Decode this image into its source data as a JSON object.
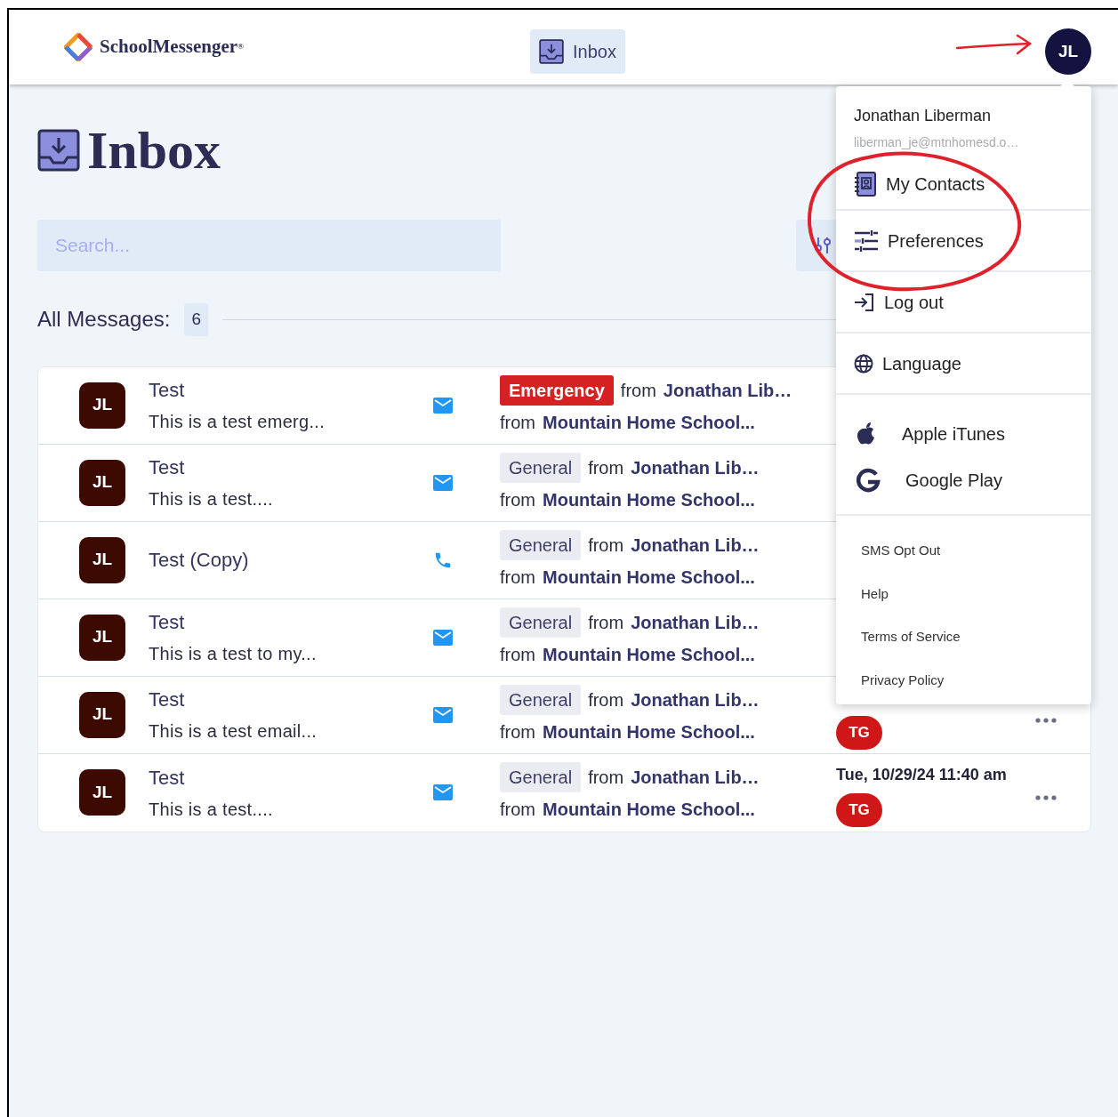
{
  "header": {
    "logo": "SchoolMessenger$^{®}$",
    "nav": [
      {
        "label": "Inbox",
        "selected": true
      }
    ],
    "avatar": "JL"
  },
  "page_title": "Inbox",
  "search": {
    "placeholder": "Search..."
  },
  "summary": {
    "label": "All Messages:",
    "count": "6"
  },
  "messages": [
    {
      "avatar": "JL",
      "title": "Test",
      "preview": "This is a test emerg...",
      "kind": "email",
      "tag": {
        "kind": "emergency",
        "label": "Emergency"
      },
      "sender_prefix": "from",
      "sender": "Jonathan Lib…",
      "org_prefix": "from",
      "org": "Mountain Home School..."
    },
    {
      "avatar": "JL",
      "title": "Test",
      "preview": "This is a test....",
      "kind": "email",
      "tag": {
        "kind": "general",
        "label": "General"
      },
      "sender_prefix": "from",
      "sender": "Jonathan Lib…",
      "org_prefix": "from",
      "org": "Mountain Home School..."
    },
    {
      "avatar": "JL",
      "title": "Test (Copy)",
      "kind": "phone",
      "tag": {
        "kind": "general",
        "label": "General"
      },
      "sender_prefix": "from",
      "sender": "Jonathan Lib…",
      "org_prefix": "from",
      "org": "Mountain Home School..."
    },
    {
      "avatar": "JL",
      "title": "Test",
      "preview": "This is a test to my...",
      "kind": "email",
      "tag": {
        "kind": "general",
        "label": "General"
      },
      "sender_prefix": "from",
      "sender": "Jonathan Lib…",
      "org_prefix": "from",
      "org": "Mountain Home School..."
    },
    {
      "avatar": "JL",
      "title": "Test",
      "preview": "This is a test email...",
      "kind": "email",
      "tag": {
        "kind": "general",
        "label": "General"
      },
      "sender_prefix": "from",
      "sender": "Jonathan Lib…",
      "org_prefix": "from",
      "org": "Mountain Home School...",
      "badge": "TG",
      "more": true
    },
    {
      "avatar": "JL",
      "title": "Test",
      "preview": "This is a test....",
      "kind": "email",
      "tag": {
        "kind": "general",
        "label": "General"
      },
      "sender_prefix": "from",
      "sender": "Jonathan Lib…",
      "org_prefix": "from",
      "org": "Mountain Home School...",
      "date": "Tue, 10/29/24 11:40 am",
      "badge": "TG",
      "more": true
    }
  ],
  "user_menu": {
    "name": "Jonathan Liberman",
    "email": "liberman_je@mtnhomesd.o…",
    "items": [
      {
        "kind": "contacts",
        "label": "My Contacts"
      },
      {
        "kind": "preferences",
        "label": "Preferences"
      },
      {
        "kind": "logout",
        "label": "Log out"
      },
      {
        "kind": "language",
        "label": "Language"
      }
    ],
    "apps": [
      {
        "kind": "apple",
        "label": "Apple iTunes"
      },
      {
        "kind": "google",
        "label": "Google Play"
      }
    ],
    "links": [
      "SMS Opt Out",
      "Help",
      "Terms of Service",
      "Privacy Policy"
    ]
  }
}
